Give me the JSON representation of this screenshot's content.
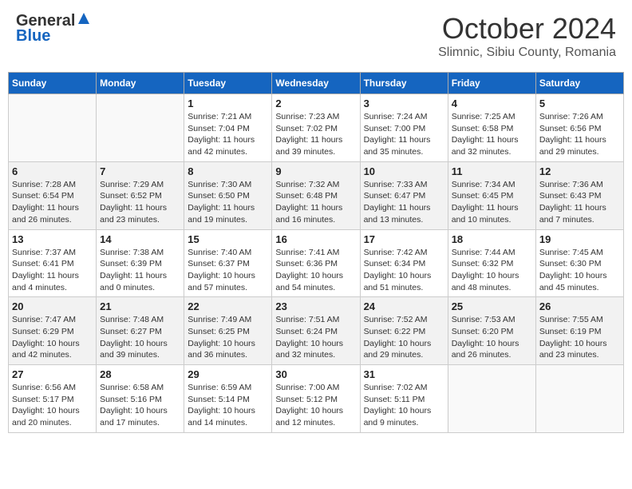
{
  "header": {
    "logo_general": "General",
    "logo_blue": "Blue",
    "month_title": "October 2024",
    "subtitle": "Slimnic, Sibiu County, Romania"
  },
  "days_of_week": [
    "Sunday",
    "Monday",
    "Tuesday",
    "Wednesday",
    "Thursday",
    "Friday",
    "Saturday"
  ],
  "weeks": [
    [
      {
        "day": "",
        "sunrise": "",
        "sunset": "",
        "daylight": ""
      },
      {
        "day": "",
        "sunrise": "",
        "sunset": "",
        "daylight": ""
      },
      {
        "day": "1",
        "sunrise": "Sunrise: 7:21 AM",
        "sunset": "Sunset: 7:04 PM",
        "daylight": "Daylight: 11 hours and 42 minutes."
      },
      {
        "day": "2",
        "sunrise": "Sunrise: 7:23 AM",
        "sunset": "Sunset: 7:02 PM",
        "daylight": "Daylight: 11 hours and 39 minutes."
      },
      {
        "day": "3",
        "sunrise": "Sunrise: 7:24 AM",
        "sunset": "Sunset: 7:00 PM",
        "daylight": "Daylight: 11 hours and 35 minutes."
      },
      {
        "day": "4",
        "sunrise": "Sunrise: 7:25 AM",
        "sunset": "Sunset: 6:58 PM",
        "daylight": "Daylight: 11 hours and 32 minutes."
      },
      {
        "day": "5",
        "sunrise": "Sunrise: 7:26 AM",
        "sunset": "Sunset: 6:56 PM",
        "daylight": "Daylight: 11 hours and 29 minutes."
      }
    ],
    [
      {
        "day": "6",
        "sunrise": "Sunrise: 7:28 AM",
        "sunset": "Sunset: 6:54 PM",
        "daylight": "Daylight: 11 hours and 26 minutes."
      },
      {
        "day": "7",
        "sunrise": "Sunrise: 7:29 AM",
        "sunset": "Sunset: 6:52 PM",
        "daylight": "Daylight: 11 hours and 23 minutes."
      },
      {
        "day": "8",
        "sunrise": "Sunrise: 7:30 AM",
        "sunset": "Sunset: 6:50 PM",
        "daylight": "Daylight: 11 hours and 19 minutes."
      },
      {
        "day": "9",
        "sunrise": "Sunrise: 7:32 AM",
        "sunset": "Sunset: 6:48 PM",
        "daylight": "Daylight: 11 hours and 16 minutes."
      },
      {
        "day": "10",
        "sunrise": "Sunrise: 7:33 AM",
        "sunset": "Sunset: 6:47 PM",
        "daylight": "Daylight: 11 hours and 13 minutes."
      },
      {
        "day": "11",
        "sunrise": "Sunrise: 7:34 AM",
        "sunset": "Sunset: 6:45 PM",
        "daylight": "Daylight: 11 hours and 10 minutes."
      },
      {
        "day": "12",
        "sunrise": "Sunrise: 7:36 AM",
        "sunset": "Sunset: 6:43 PM",
        "daylight": "Daylight: 11 hours and 7 minutes."
      }
    ],
    [
      {
        "day": "13",
        "sunrise": "Sunrise: 7:37 AM",
        "sunset": "Sunset: 6:41 PM",
        "daylight": "Daylight: 11 hours and 4 minutes."
      },
      {
        "day": "14",
        "sunrise": "Sunrise: 7:38 AM",
        "sunset": "Sunset: 6:39 PM",
        "daylight": "Daylight: 11 hours and 0 minutes."
      },
      {
        "day": "15",
        "sunrise": "Sunrise: 7:40 AM",
        "sunset": "Sunset: 6:37 PM",
        "daylight": "Daylight: 10 hours and 57 minutes."
      },
      {
        "day": "16",
        "sunrise": "Sunrise: 7:41 AM",
        "sunset": "Sunset: 6:36 PM",
        "daylight": "Daylight: 10 hours and 54 minutes."
      },
      {
        "day": "17",
        "sunrise": "Sunrise: 7:42 AM",
        "sunset": "Sunset: 6:34 PM",
        "daylight": "Daylight: 10 hours and 51 minutes."
      },
      {
        "day": "18",
        "sunrise": "Sunrise: 7:44 AM",
        "sunset": "Sunset: 6:32 PM",
        "daylight": "Daylight: 10 hours and 48 minutes."
      },
      {
        "day": "19",
        "sunrise": "Sunrise: 7:45 AM",
        "sunset": "Sunset: 6:30 PM",
        "daylight": "Daylight: 10 hours and 45 minutes."
      }
    ],
    [
      {
        "day": "20",
        "sunrise": "Sunrise: 7:47 AM",
        "sunset": "Sunset: 6:29 PM",
        "daylight": "Daylight: 10 hours and 42 minutes."
      },
      {
        "day": "21",
        "sunrise": "Sunrise: 7:48 AM",
        "sunset": "Sunset: 6:27 PM",
        "daylight": "Daylight: 10 hours and 39 minutes."
      },
      {
        "day": "22",
        "sunrise": "Sunrise: 7:49 AM",
        "sunset": "Sunset: 6:25 PM",
        "daylight": "Daylight: 10 hours and 36 minutes."
      },
      {
        "day": "23",
        "sunrise": "Sunrise: 7:51 AM",
        "sunset": "Sunset: 6:24 PM",
        "daylight": "Daylight: 10 hours and 32 minutes."
      },
      {
        "day": "24",
        "sunrise": "Sunrise: 7:52 AM",
        "sunset": "Sunset: 6:22 PM",
        "daylight": "Daylight: 10 hours and 29 minutes."
      },
      {
        "day": "25",
        "sunrise": "Sunrise: 7:53 AM",
        "sunset": "Sunset: 6:20 PM",
        "daylight": "Daylight: 10 hours and 26 minutes."
      },
      {
        "day": "26",
        "sunrise": "Sunrise: 7:55 AM",
        "sunset": "Sunset: 6:19 PM",
        "daylight": "Daylight: 10 hours and 23 minutes."
      }
    ],
    [
      {
        "day": "27",
        "sunrise": "Sunrise: 6:56 AM",
        "sunset": "Sunset: 5:17 PM",
        "daylight": "Daylight: 10 hours and 20 minutes."
      },
      {
        "day": "28",
        "sunrise": "Sunrise: 6:58 AM",
        "sunset": "Sunset: 5:16 PM",
        "daylight": "Daylight: 10 hours and 17 minutes."
      },
      {
        "day": "29",
        "sunrise": "Sunrise: 6:59 AM",
        "sunset": "Sunset: 5:14 PM",
        "daylight": "Daylight: 10 hours and 14 minutes."
      },
      {
        "day": "30",
        "sunrise": "Sunrise: 7:00 AM",
        "sunset": "Sunset: 5:12 PM",
        "daylight": "Daylight: 10 hours and 12 minutes."
      },
      {
        "day": "31",
        "sunrise": "Sunrise: 7:02 AM",
        "sunset": "Sunset: 5:11 PM",
        "daylight": "Daylight: 10 hours and 9 minutes."
      },
      {
        "day": "",
        "sunrise": "",
        "sunset": "",
        "daylight": ""
      },
      {
        "day": "",
        "sunrise": "",
        "sunset": "",
        "daylight": ""
      }
    ]
  ]
}
